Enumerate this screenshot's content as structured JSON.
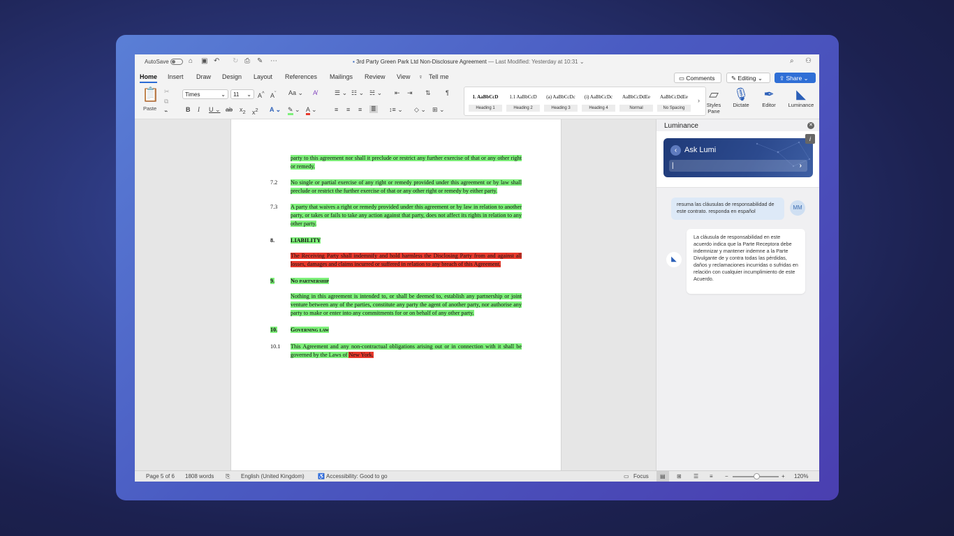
{
  "titlebar": {
    "autosave_label": "AutoSave",
    "doc_title": "3rd Party Green Park Ltd Non-Disclosure Agreement",
    "last_modified": "— Last Modified: Yesterday at 10:31"
  },
  "tabs": [
    "Home",
    "Insert",
    "Draw",
    "Design",
    "Layout",
    "References",
    "Mailings",
    "Review",
    "View",
    "Tell me"
  ],
  "actions": {
    "comments": "Comments",
    "editing": "Editing",
    "share": "Share"
  },
  "ribbon": {
    "paste": "Paste",
    "font": "Times",
    "size": "11",
    "styles": [
      {
        "preview": "1.  AaBbCcD",
        "name": "Heading 1"
      },
      {
        "preview": "1.1  AaBbCcD",
        "name": "Heading 2"
      },
      {
        "preview": "(a)  AaBbCcDc",
        "name": "Heading 3"
      },
      {
        "preview": "(i)  AaBbCcDc",
        "name": "Heading 4"
      },
      {
        "preview": "AaBbCcDdEe",
        "name": "Normal"
      },
      {
        "preview": "AaBbCcDdEe",
        "name": "No Spacing"
      }
    ],
    "styles_pane": "Styles Pane",
    "dictate": "Dictate",
    "editor": "Editor",
    "luminance": "Luminance"
  },
  "document": {
    "p_cont": "party to this agreement nor shall it preclude or restrict any further exercise of that or any other right or remedy.",
    "n_7_2": "7.2",
    "p_7_2": "No single or partial exercise of any right or remedy provided under this agreement or by law shall preclude or restrict the further exercise of that or any other right or remedy by either party.",
    "n_7_3": "7.3",
    "p_7_3": "A party that waives a right or remedy provided under this agreement or by law in relation to another party, or takes or fails to take any action against that party, does not affect its rights in relation to any other party.",
    "n_8": "8.",
    "h_8": "LIABILITY",
    "p_8": "The Receiving Party shall indemnify and hold harmless the Disclosing Party from and against all losses, damages and claims incurred or suffered in relation to any breach of this Agreement.",
    "n_9": "9.",
    "h_9": "No partnership",
    "p_9": "Nothing in this agreement is intended to, or shall be deemed to, establish any partnership or joint venture between any of the parties, constitute any party the agent of another party, nor authorise any party to make or enter into any commitments for or on behalf of any other party.",
    "n_10": "10.",
    "h_10": "Governing law",
    "n_10_1": "10.1",
    "p_10_1a": "This Agreement and any non-contractual obligations arising out or in connection with it shall be governed by the Laws of ",
    "p_10_1b": "New York."
  },
  "panel": {
    "title": "Luminance",
    "ask": "Ask Lumi",
    "cursor": "|",
    "go": "›",
    "info": "i",
    "user_msg": "resuma las cláusulas de responsabilidad de este contrato. responda en español",
    "user_initials": "MM",
    "bot_msg": "La cláusula de responsabilidad en este acuerdo indica que la Parte Receptora debe indemnizar y mantener indemne a la Parte Divulgante de y contra todas las pérdidas, daños y reclamaciones incurridas o sufridas en relación con cualquier incumplimiento de este Acuerdo."
  },
  "status": {
    "page": "Page 5 of 6",
    "words": "1808 words",
    "language": "English (United Kingdom)",
    "accessibility": "Accessibility: Good to go",
    "focus": "Focus",
    "zoom": "120%"
  },
  "colors": {
    "accent": "#2f6fd6",
    "highlight_green": "#7ef07a",
    "highlight_red": "#e8392c"
  }
}
